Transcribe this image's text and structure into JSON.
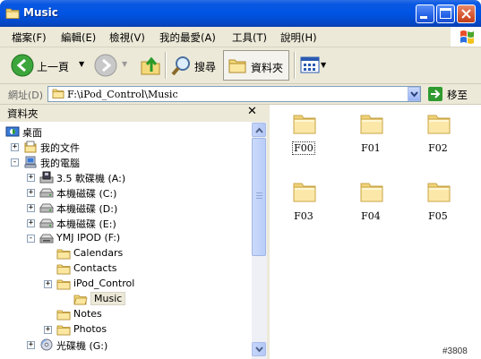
{
  "window": {
    "title": "Music",
    "colors": {
      "titlebar": "#0054e3",
      "chrome": "#ece9d8",
      "close": "#d85a35"
    }
  },
  "menu": [
    "檔案(F)",
    "編輯(E)",
    "檢視(V)",
    "我的最愛(A)",
    "工具(T)",
    "說明(H)"
  ],
  "toolbar": {
    "back_label": "上一頁",
    "search_label": "搜尋",
    "folders_label": "資料夾"
  },
  "address": {
    "label": "網址(D)",
    "value": "F:\\iPod_Control\\Music",
    "go_label": "移至"
  },
  "folders_pane": {
    "title": "資料夾",
    "tree": [
      {
        "label": "桌面",
        "icon": "desktop-icon",
        "expander": ""
      },
      {
        "label": "我的文件",
        "icon": "my-documents-icon",
        "expander": "+"
      },
      {
        "label": "我的電腦",
        "icon": "my-computer-icon",
        "expander": "-"
      },
      {
        "label": "3.5 軟碟機 (A:)",
        "icon": "floppy-drive-icon",
        "expander": "+"
      },
      {
        "label": "本機磁碟 (C:)",
        "icon": "hard-drive-icon",
        "expander": "+"
      },
      {
        "label": "本機磁碟 (D:)",
        "icon": "hard-drive-icon",
        "expander": "+"
      },
      {
        "label": "本機磁碟 (E:)",
        "icon": "hard-drive-icon",
        "expander": "+"
      },
      {
        "label": "YMJ IPOD (F:)",
        "icon": "removable-drive-icon",
        "expander": "-"
      },
      {
        "label": "Calendars",
        "icon": "folder-icon",
        "expander": ""
      },
      {
        "label": "Contacts",
        "icon": "folder-icon",
        "expander": ""
      },
      {
        "label": "iPod_Control",
        "icon": "folder-icon",
        "expander": "+"
      },
      {
        "label": "Music",
        "icon": "open-folder-icon",
        "expander": "",
        "selected": true
      },
      {
        "label": "Notes",
        "icon": "folder-icon",
        "expander": ""
      },
      {
        "label": "Photos",
        "icon": "folder-icon",
        "expander": "+"
      },
      {
        "label": "光碟機 (G:)",
        "icon": "cd-drive-icon",
        "expander": "+"
      }
    ]
  },
  "content": {
    "folders": [
      "F00",
      "F01",
      "F02",
      "F03",
      "F04",
      "F05"
    ]
  },
  "watermark": "#3808"
}
